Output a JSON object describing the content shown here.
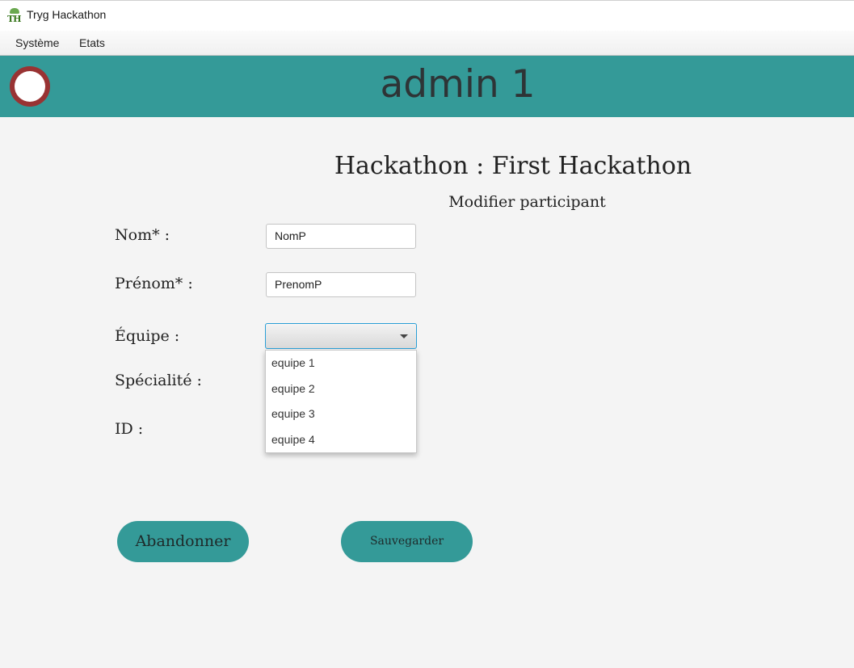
{
  "window": {
    "title": "Tryg Hackathon",
    "icon_text": "TH"
  },
  "menu": {
    "items": [
      "Système",
      "Etats"
    ]
  },
  "header": {
    "user": "admin 1",
    "avatar_color": "#993333",
    "band_color": "#349a98"
  },
  "form": {
    "title": "Hackathon : First Hackathon",
    "subtitle": "Modifier participant",
    "labels": {
      "nom": "Nom* :",
      "prenom": "Prénom* :",
      "equipe": "Équipe :",
      "specialite": "Spécialité :",
      "id": "ID :"
    },
    "values": {
      "nom": "NomP",
      "prenom": "PrenomP",
      "equipe": ""
    },
    "equipe_options": [
      "equipe 1",
      "equipe 2",
      "equipe 3",
      "equipe 4"
    ]
  },
  "buttons": {
    "cancel": "Abandonner",
    "save": "Sauvegarder"
  }
}
